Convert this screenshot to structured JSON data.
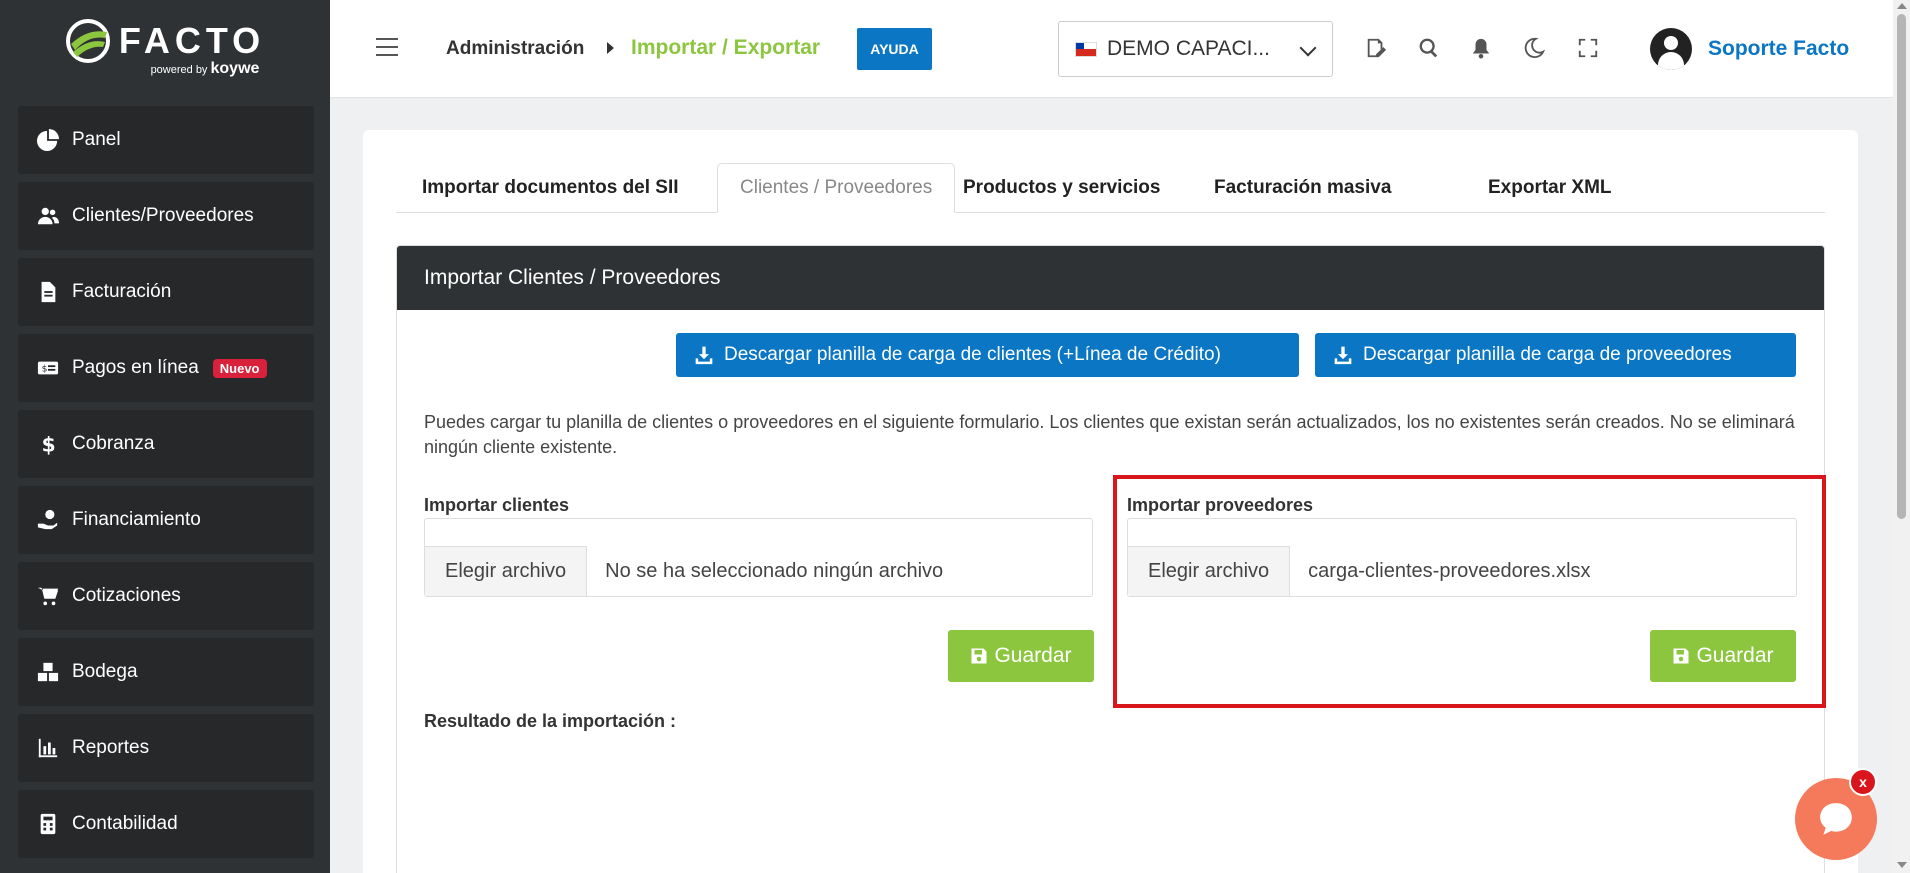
{
  "logo": {
    "text": "FACTO",
    "powered": "powered by",
    "brand": "koywe"
  },
  "sidebar": {
    "items": [
      {
        "label": "Panel",
        "icon": "pie-chart-icon"
      },
      {
        "label": "Clientes/Proveedores",
        "icon": "users-icon"
      },
      {
        "label": "Facturación",
        "icon": "document-icon"
      },
      {
        "label": "Pagos en línea",
        "icon": "money-card-icon",
        "badge": "Nuevo"
      },
      {
        "label": "Cobranza",
        "icon": "dollar-icon"
      },
      {
        "label": "Financiamiento",
        "icon": "hand-coin-icon"
      },
      {
        "label": "Cotizaciones",
        "icon": "cart-icon"
      },
      {
        "label": "Bodega",
        "icon": "boxes-icon"
      },
      {
        "label": "Reportes",
        "icon": "bar-chart-icon"
      },
      {
        "label": "Contabilidad",
        "icon": "calculator-icon"
      }
    ]
  },
  "header": {
    "breadcrumb_root": "Administración",
    "breadcrumb_current": "Importar / Exportar",
    "help_label": "AYUDA",
    "company": "DEMO CAPACI...",
    "user_name": "Soporte Facto"
  },
  "tabs": [
    {
      "label": "Importar documentos del SII"
    },
    {
      "label": "Clientes / Proveedores"
    },
    {
      "label": "Productos y servicios"
    },
    {
      "label": "Facturación masiva"
    },
    {
      "label": "Exportar XML"
    }
  ],
  "panel": {
    "title": "Importar Clientes / Proveedores",
    "download_clients": "Descargar planilla de carga de clientes (+Línea de Crédito)",
    "download_providers": "Descargar planilla de carga de proveedores",
    "description": "Puedes cargar tu planilla de clientes o proveedores en el siguiente formulario. Los clientes que existan serán actualizados, los no existentes serán creados. No se eliminará ningún cliente existente.",
    "clients_label": "Importar clientes",
    "providers_label": "Importar proveedores",
    "choose_file": "Elegir archivo",
    "clients_file": "No se ha seleccionado ningún archivo",
    "providers_file": "carga-clientes-proveedores.xlsx",
    "save_label": "Guardar",
    "result_label": "Resultado de la importación :"
  },
  "chat": {
    "close": "x"
  },
  "colors": {
    "accent_green": "#8cc63f",
    "accent_blue": "#0a76c4",
    "sidebar": "#2f3234",
    "highlight": "#d9161c"
  }
}
